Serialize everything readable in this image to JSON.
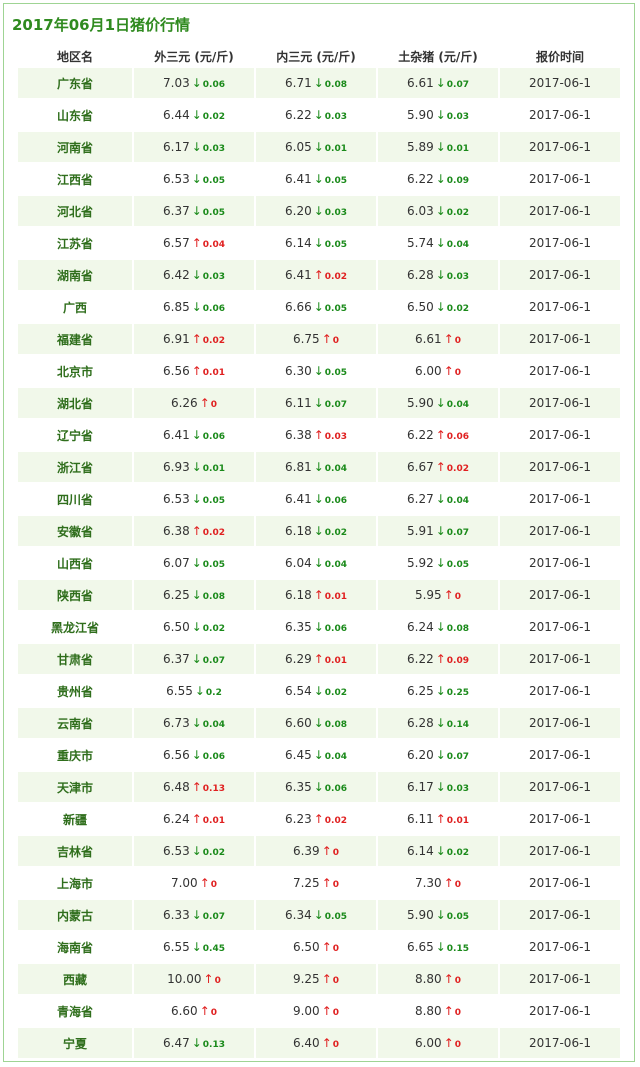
{
  "title": "2017年06月1日猪价行情",
  "headers": [
    "地区名",
    "外三元 (元/斤)",
    "内三元 (元/斤)",
    "土杂猪 (元/斤)",
    "报价时间"
  ],
  "colors": {
    "up": "#e02020",
    "down": "#1a8a1a",
    "accent": "#2f8a1f"
  },
  "rows": [
    {
      "region": "广东省",
      "c1": {
        "price": "7.03",
        "dir": "down",
        "chg": "0.06"
      },
      "c2": {
        "price": "6.71",
        "dir": "down",
        "chg": "0.08"
      },
      "c3": {
        "price": "6.61",
        "dir": "down",
        "chg": "0.07"
      },
      "date": "2017-06-1"
    },
    {
      "region": "山东省",
      "c1": {
        "price": "6.44",
        "dir": "down",
        "chg": "0.02"
      },
      "c2": {
        "price": "6.22",
        "dir": "down",
        "chg": "0.03"
      },
      "c3": {
        "price": "5.90",
        "dir": "down",
        "chg": "0.03"
      },
      "date": "2017-06-1"
    },
    {
      "region": "河南省",
      "c1": {
        "price": "6.17",
        "dir": "down",
        "chg": "0.03"
      },
      "c2": {
        "price": "6.05",
        "dir": "down",
        "chg": "0.01"
      },
      "c3": {
        "price": "5.89",
        "dir": "down",
        "chg": "0.01"
      },
      "date": "2017-06-1"
    },
    {
      "region": "江西省",
      "c1": {
        "price": "6.53",
        "dir": "down",
        "chg": "0.05"
      },
      "c2": {
        "price": "6.41",
        "dir": "down",
        "chg": "0.05"
      },
      "c3": {
        "price": "6.22",
        "dir": "down",
        "chg": "0.09"
      },
      "date": "2017-06-1"
    },
    {
      "region": "河北省",
      "c1": {
        "price": "6.37",
        "dir": "down",
        "chg": "0.05"
      },
      "c2": {
        "price": "6.20",
        "dir": "down",
        "chg": "0.03"
      },
      "c3": {
        "price": "6.03",
        "dir": "down",
        "chg": "0.02"
      },
      "date": "2017-06-1"
    },
    {
      "region": "江苏省",
      "c1": {
        "price": "6.57",
        "dir": "up",
        "chg": "0.04"
      },
      "c2": {
        "price": "6.14",
        "dir": "down",
        "chg": "0.05"
      },
      "c3": {
        "price": "5.74",
        "dir": "down",
        "chg": "0.04"
      },
      "date": "2017-06-1"
    },
    {
      "region": "湖南省",
      "c1": {
        "price": "6.42",
        "dir": "down",
        "chg": "0.03"
      },
      "c2": {
        "price": "6.41",
        "dir": "up",
        "chg": "0.02"
      },
      "c3": {
        "price": "6.28",
        "dir": "down",
        "chg": "0.03"
      },
      "date": "2017-06-1"
    },
    {
      "region": "广西",
      "c1": {
        "price": "6.85",
        "dir": "down",
        "chg": "0.06"
      },
      "c2": {
        "price": "6.66",
        "dir": "down",
        "chg": "0.05"
      },
      "c3": {
        "price": "6.50",
        "dir": "down",
        "chg": "0.02"
      },
      "date": "2017-06-1"
    },
    {
      "region": "福建省",
      "c1": {
        "price": "6.91",
        "dir": "up",
        "chg": "0.02"
      },
      "c2": {
        "price": "6.75",
        "dir": "up",
        "chg": "0"
      },
      "c3": {
        "price": "6.61",
        "dir": "up",
        "chg": "0"
      },
      "date": "2017-06-1"
    },
    {
      "region": "北京市",
      "c1": {
        "price": "6.56",
        "dir": "up",
        "chg": "0.01"
      },
      "c2": {
        "price": "6.30",
        "dir": "down",
        "chg": "0.05"
      },
      "c3": {
        "price": "6.00",
        "dir": "up",
        "chg": "0"
      },
      "date": "2017-06-1"
    },
    {
      "region": "湖北省",
      "c1": {
        "price": "6.26",
        "dir": "up",
        "chg": "0"
      },
      "c2": {
        "price": "6.11",
        "dir": "down",
        "chg": "0.07"
      },
      "c3": {
        "price": "5.90",
        "dir": "down",
        "chg": "0.04"
      },
      "date": "2017-06-1"
    },
    {
      "region": "辽宁省",
      "c1": {
        "price": "6.41",
        "dir": "down",
        "chg": "0.06"
      },
      "c2": {
        "price": "6.38",
        "dir": "up",
        "chg": "0.03"
      },
      "c3": {
        "price": "6.22",
        "dir": "up",
        "chg": "0.06"
      },
      "date": "2017-06-1"
    },
    {
      "region": "浙江省",
      "c1": {
        "price": "6.93",
        "dir": "down",
        "chg": "0.01"
      },
      "c2": {
        "price": "6.81",
        "dir": "down",
        "chg": "0.04"
      },
      "c3": {
        "price": "6.67",
        "dir": "up",
        "chg": "0.02"
      },
      "date": "2017-06-1"
    },
    {
      "region": "四川省",
      "c1": {
        "price": "6.53",
        "dir": "down",
        "chg": "0.05"
      },
      "c2": {
        "price": "6.41",
        "dir": "down",
        "chg": "0.06"
      },
      "c3": {
        "price": "6.27",
        "dir": "down",
        "chg": "0.04"
      },
      "date": "2017-06-1"
    },
    {
      "region": "安徽省",
      "c1": {
        "price": "6.38",
        "dir": "up",
        "chg": "0.02"
      },
      "c2": {
        "price": "6.18",
        "dir": "down",
        "chg": "0.02"
      },
      "c3": {
        "price": "5.91",
        "dir": "down",
        "chg": "0.07"
      },
      "date": "2017-06-1"
    },
    {
      "region": "山西省",
      "c1": {
        "price": "6.07",
        "dir": "down",
        "chg": "0.05"
      },
      "c2": {
        "price": "6.04",
        "dir": "down",
        "chg": "0.04"
      },
      "c3": {
        "price": "5.92",
        "dir": "down",
        "chg": "0.05"
      },
      "date": "2017-06-1"
    },
    {
      "region": "陕西省",
      "c1": {
        "price": "6.25",
        "dir": "down",
        "chg": "0.08"
      },
      "c2": {
        "price": "6.18",
        "dir": "up",
        "chg": "0.01"
      },
      "c3": {
        "price": "5.95",
        "dir": "up",
        "chg": "0"
      },
      "date": "2017-06-1"
    },
    {
      "region": "黑龙江省",
      "c1": {
        "price": "6.50",
        "dir": "down",
        "chg": "0.02"
      },
      "c2": {
        "price": "6.35",
        "dir": "down",
        "chg": "0.06"
      },
      "c3": {
        "price": "6.24",
        "dir": "down",
        "chg": "0.08"
      },
      "date": "2017-06-1"
    },
    {
      "region": "甘肃省",
      "c1": {
        "price": "6.37",
        "dir": "down",
        "chg": "0.07"
      },
      "c2": {
        "price": "6.29",
        "dir": "up",
        "chg": "0.01"
      },
      "c3": {
        "price": "6.22",
        "dir": "up",
        "chg": "0.09"
      },
      "date": "2017-06-1"
    },
    {
      "region": "贵州省",
      "c1": {
        "price": "6.55",
        "dir": "down",
        "chg": "0.2"
      },
      "c2": {
        "price": "6.54",
        "dir": "down",
        "chg": "0.02"
      },
      "c3": {
        "price": "6.25",
        "dir": "down",
        "chg": "0.25"
      },
      "date": "2017-06-1"
    },
    {
      "region": "云南省",
      "c1": {
        "price": "6.73",
        "dir": "down",
        "chg": "0.04"
      },
      "c2": {
        "price": "6.60",
        "dir": "down",
        "chg": "0.08"
      },
      "c3": {
        "price": "6.28",
        "dir": "down",
        "chg": "0.14"
      },
      "date": "2017-06-1"
    },
    {
      "region": "重庆市",
      "c1": {
        "price": "6.56",
        "dir": "down",
        "chg": "0.06"
      },
      "c2": {
        "price": "6.45",
        "dir": "down",
        "chg": "0.04"
      },
      "c3": {
        "price": "6.20",
        "dir": "down",
        "chg": "0.07"
      },
      "date": "2017-06-1"
    },
    {
      "region": "天津市",
      "c1": {
        "price": "6.48",
        "dir": "up",
        "chg": "0.13"
      },
      "c2": {
        "price": "6.35",
        "dir": "down",
        "chg": "0.06"
      },
      "c3": {
        "price": "6.17",
        "dir": "down",
        "chg": "0.03"
      },
      "date": "2017-06-1"
    },
    {
      "region": "新疆",
      "c1": {
        "price": "6.24",
        "dir": "up",
        "chg": "0.01"
      },
      "c2": {
        "price": "6.23",
        "dir": "up",
        "chg": "0.02"
      },
      "c3": {
        "price": "6.11",
        "dir": "up",
        "chg": "0.01"
      },
      "date": "2017-06-1"
    },
    {
      "region": "吉林省",
      "c1": {
        "price": "6.53",
        "dir": "down",
        "chg": "0.02"
      },
      "c2": {
        "price": "6.39",
        "dir": "up",
        "chg": "0"
      },
      "c3": {
        "price": "6.14",
        "dir": "down",
        "chg": "0.02"
      },
      "date": "2017-06-1"
    },
    {
      "region": "上海市",
      "c1": {
        "price": "7.00",
        "dir": "up",
        "chg": "0"
      },
      "c2": {
        "price": "7.25",
        "dir": "up",
        "chg": "0"
      },
      "c3": {
        "price": "7.30",
        "dir": "up",
        "chg": "0"
      },
      "date": "2017-06-1"
    },
    {
      "region": "内蒙古",
      "c1": {
        "price": "6.33",
        "dir": "down",
        "chg": "0.07"
      },
      "c2": {
        "price": "6.34",
        "dir": "down",
        "chg": "0.05"
      },
      "c3": {
        "price": "5.90",
        "dir": "down",
        "chg": "0.05"
      },
      "date": "2017-06-1"
    },
    {
      "region": "海南省",
      "c1": {
        "price": "6.55",
        "dir": "down",
        "chg": "0.45"
      },
      "c2": {
        "price": "6.50",
        "dir": "up",
        "chg": "0"
      },
      "c3": {
        "price": "6.65",
        "dir": "down",
        "chg": "0.15"
      },
      "date": "2017-06-1"
    },
    {
      "region": "西藏",
      "c1": {
        "price": "10.00",
        "dir": "up",
        "chg": "0"
      },
      "c2": {
        "price": "9.25",
        "dir": "up",
        "chg": "0"
      },
      "c3": {
        "price": "8.80",
        "dir": "up",
        "chg": "0"
      },
      "date": "2017-06-1"
    },
    {
      "region": "青海省",
      "c1": {
        "price": "6.60",
        "dir": "up",
        "chg": "0"
      },
      "c2": {
        "price": "9.00",
        "dir": "up",
        "chg": "0"
      },
      "c3": {
        "price": "8.80",
        "dir": "up",
        "chg": "0"
      },
      "date": "2017-06-1"
    },
    {
      "region": "宁夏",
      "c1": {
        "price": "6.47",
        "dir": "down",
        "chg": "0.13"
      },
      "c2": {
        "price": "6.40",
        "dir": "up",
        "chg": "0"
      },
      "c3": {
        "price": "6.00",
        "dir": "up",
        "chg": "0"
      },
      "date": "2017-06-1"
    }
  ]
}
